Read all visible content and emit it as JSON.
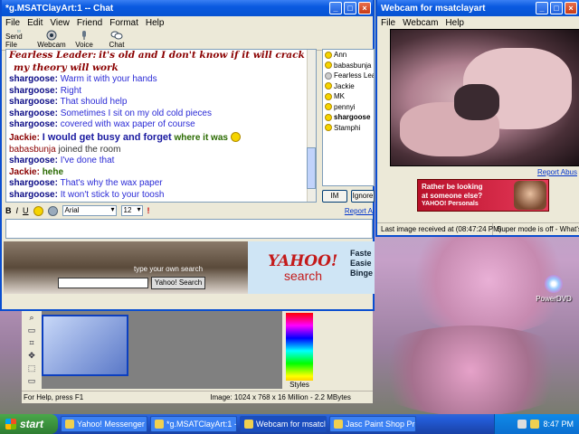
{
  "chat_window": {
    "title": "*g.MSATClayArt:1 -- Chat",
    "menu": [
      "File",
      "Edit",
      "View",
      "Friend",
      "Format",
      "Help"
    ],
    "toolbar": [
      "Send File",
      "Webcam",
      "Voice",
      "Chat"
    ],
    "messages": [
      {
        "sender": "Fearless Leader:",
        "text": "it's old and I don't know if it will crack or if",
        "style": "script"
      },
      {
        "sender": "",
        "text": "my theory will work",
        "style": "script"
      },
      {
        "sender": "shargoose:",
        "text": "Warm it with your hands",
        "style": "normal"
      },
      {
        "sender": "shargoose:",
        "text": "Right",
        "style": "normal"
      },
      {
        "sender": "shargoose:",
        "text": "That should help",
        "style": "normal"
      },
      {
        "sender": "shargoose:",
        "text": "Sometimes I sit on my old cold pieces",
        "style": "normal"
      },
      {
        "sender": "shargoose:",
        "text": "covered with wax paper of course",
        "style": "normal"
      },
      {
        "sender": "Jackie:",
        "text": "I would get busy and forget",
        "text2": "where it was",
        "style": "jackie-mixed"
      },
      {
        "sender": "babasbunja",
        "text": "joined the room",
        "style": "system"
      },
      {
        "sender": "shargoose:",
        "text": "I've done that",
        "style": "normal"
      },
      {
        "sender": "Jackie:",
        "text": "hehe",
        "style": "jackie"
      },
      {
        "sender": "shargoose:",
        "text": "That's why the wax paper",
        "style": "normal"
      },
      {
        "sender": "shargoose:",
        "text": "It won't stick to your toosh",
        "style": "normal"
      }
    ],
    "users": [
      "Ann",
      "babasbunja",
      "Fearless Leader",
      "Jackie",
      "MK",
      "pennyi",
      "shargoose",
      "Stamphi"
    ],
    "bold_user": "shargoose",
    "im_button": "IM",
    "ignore_button": "Ignore",
    "report_link": "Report A",
    "font_name": "Arial",
    "font_size": "12",
    "format_buttons": [
      "B",
      "I",
      "U"
    ],
    "ad": {
      "search_label": "type your own search",
      "search_button": "Yahoo! Search",
      "brand": "YAHOO!",
      "brand_sub": "search",
      "tagline": "Faste\nEasie\nBinge"
    }
  },
  "paint_shop": {
    "status_help": "For Help, press F1",
    "status_image": "Image:  1024 x 768 x 16 Million - 2.2 MBytes",
    "styles_label": "Styles"
  },
  "webcam_window": {
    "title": "Webcam for msatclayart",
    "menu": [
      "File",
      "Webcam",
      "Help"
    ],
    "report_link": "Report Abus",
    "ad_line1": "Rather be looking",
    "ad_line2": "at someone else?",
    "ad_brand": "YAHOO! Personals",
    "last_image": "Last image received at (08:47:24 PM)",
    "super_mode": "Super mode is off - What's this"
  },
  "desktop_icon": "PowerDVD",
  "taskbar": {
    "start": "start",
    "tasks": [
      "Yahoo! Messenger (I...",
      "*g.MSATClayArt:1 -...",
      "Webcam for msatclay...",
      "Jasc Paint Shop Pro -..."
    ],
    "clock": "8:47 PM"
  }
}
